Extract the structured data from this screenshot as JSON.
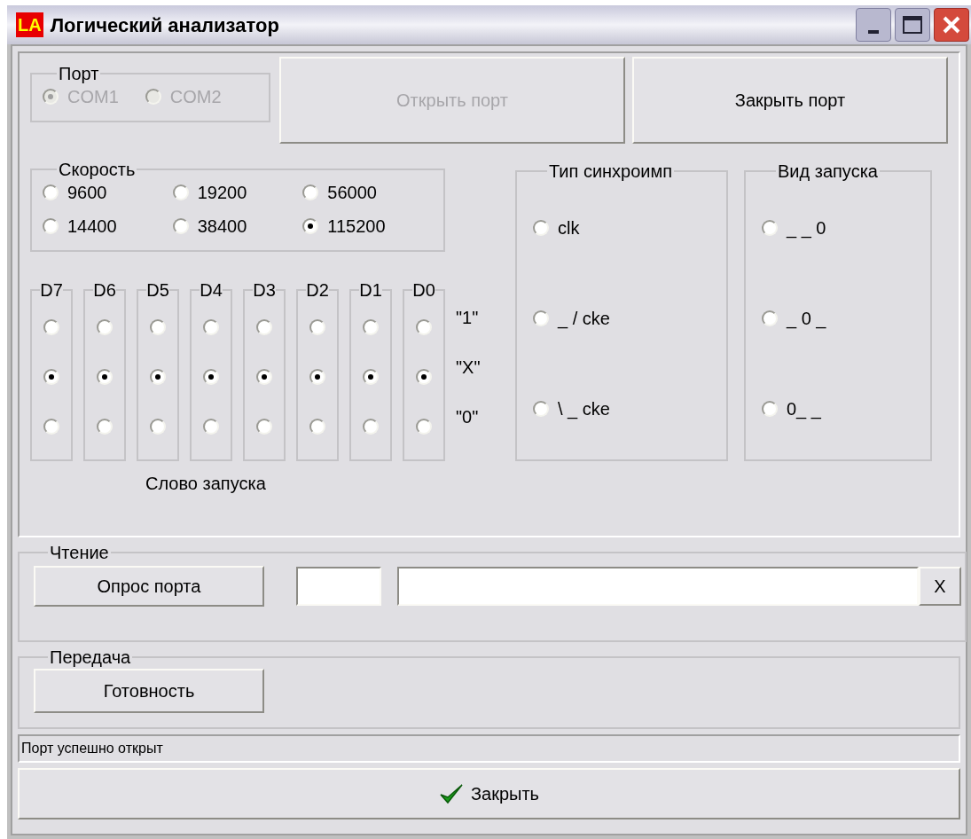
{
  "window": {
    "title": "Логический анализатор",
    "icon_text": "LA"
  },
  "port": {
    "label": "Порт",
    "disabled": true,
    "options": [
      {
        "label": "COM1",
        "selected": true
      },
      {
        "label": "COM2",
        "selected": false
      }
    ]
  },
  "port_buttons": [
    {
      "label": "Открыть порт",
      "disabled": true
    },
    {
      "label": "Закрыть порт",
      "disabled": false
    }
  ],
  "speed": {
    "label": "Скорость",
    "options": [
      {
        "label": "9600",
        "selected": false
      },
      {
        "label": "19200",
        "selected": false
      },
      {
        "label": "56000",
        "selected": false
      },
      {
        "label": "14400",
        "selected": false
      },
      {
        "label": "38400",
        "selected": false
      },
      {
        "label": "115200",
        "selected": true
      }
    ]
  },
  "trigger_word": {
    "caption": "Слово запуска",
    "row_labels": [
      "\"1\"",
      "\"X\"",
      "\"0\""
    ],
    "bits": [
      {
        "label": "D7",
        "options": [
          {
            "selected": false
          },
          {
            "selected": true
          },
          {
            "selected": false
          }
        ]
      },
      {
        "label": "D6",
        "options": [
          {
            "selected": false
          },
          {
            "selected": true
          },
          {
            "selected": false
          }
        ]
      },
      {
        "label": "D5",
        "options": [
          {
            "selected": false
          },
          {
            "selected": true
          },
          {
            "selected": false
          }
        ]
      },
      {
        "label": "D4",
        "options": [
          {
            "selected": false
          },
          {
            "selected": true
          },
          {
            "selected": false
          }
        ]
      },
      {
        "label": "D3",
        "options": [
          {
            "selected": false
          },
          {
            "selected": true
          },
          {
            "selected": false
          }
        ]
      },
      {
        "label": "D2",
        "options": [
          {
            "selected": false
          },
          {
            "selected": true
          },
          {
            "selected": false
          }
        ]
      },
      {
        "label": "D1",
        "options": [
          {
            "selected": false
          },
          {
            "selected": true
          },
          {
            "selected": false
          }
        ]
      },
      {
        "label": "D0",
        "options": [
          {
            "selected": false
          },
          {
            "selected": true
          },
          {
            "selected": false
          }
        ]
      }
    ]
  },
  "sync_type": {
    "label": "Тип синхроимп",
    "options": [
      {
        "label": "clk",
        "selected": false
      },
      {
        "label": "_ / cke",
        "selected": false
      },
      {
        "label": "\\ _ cke",
        "selected": false
      }
    ]
  },
  "trigger_type": {
    "label": "Вид запуска",
    "options": [
      {
        "label": "_ _ 0",
        "selected": false
      },
      {
        "label": "_ 0 _",
        "selected": false
      },
      {
        "label": "0_ _",
        "selected": false
      }
    ]
  },
  "reading": {
    "label": "Чтение",
    "button": "Опрос порта",
    "clear_button": "X"
  },
  "transmit": {
    "label": "Передача",
    "button": "Готовность"
  },
  "status_bar": "Порт успешно открыт",
  "close_button": "Закрыть"
}
